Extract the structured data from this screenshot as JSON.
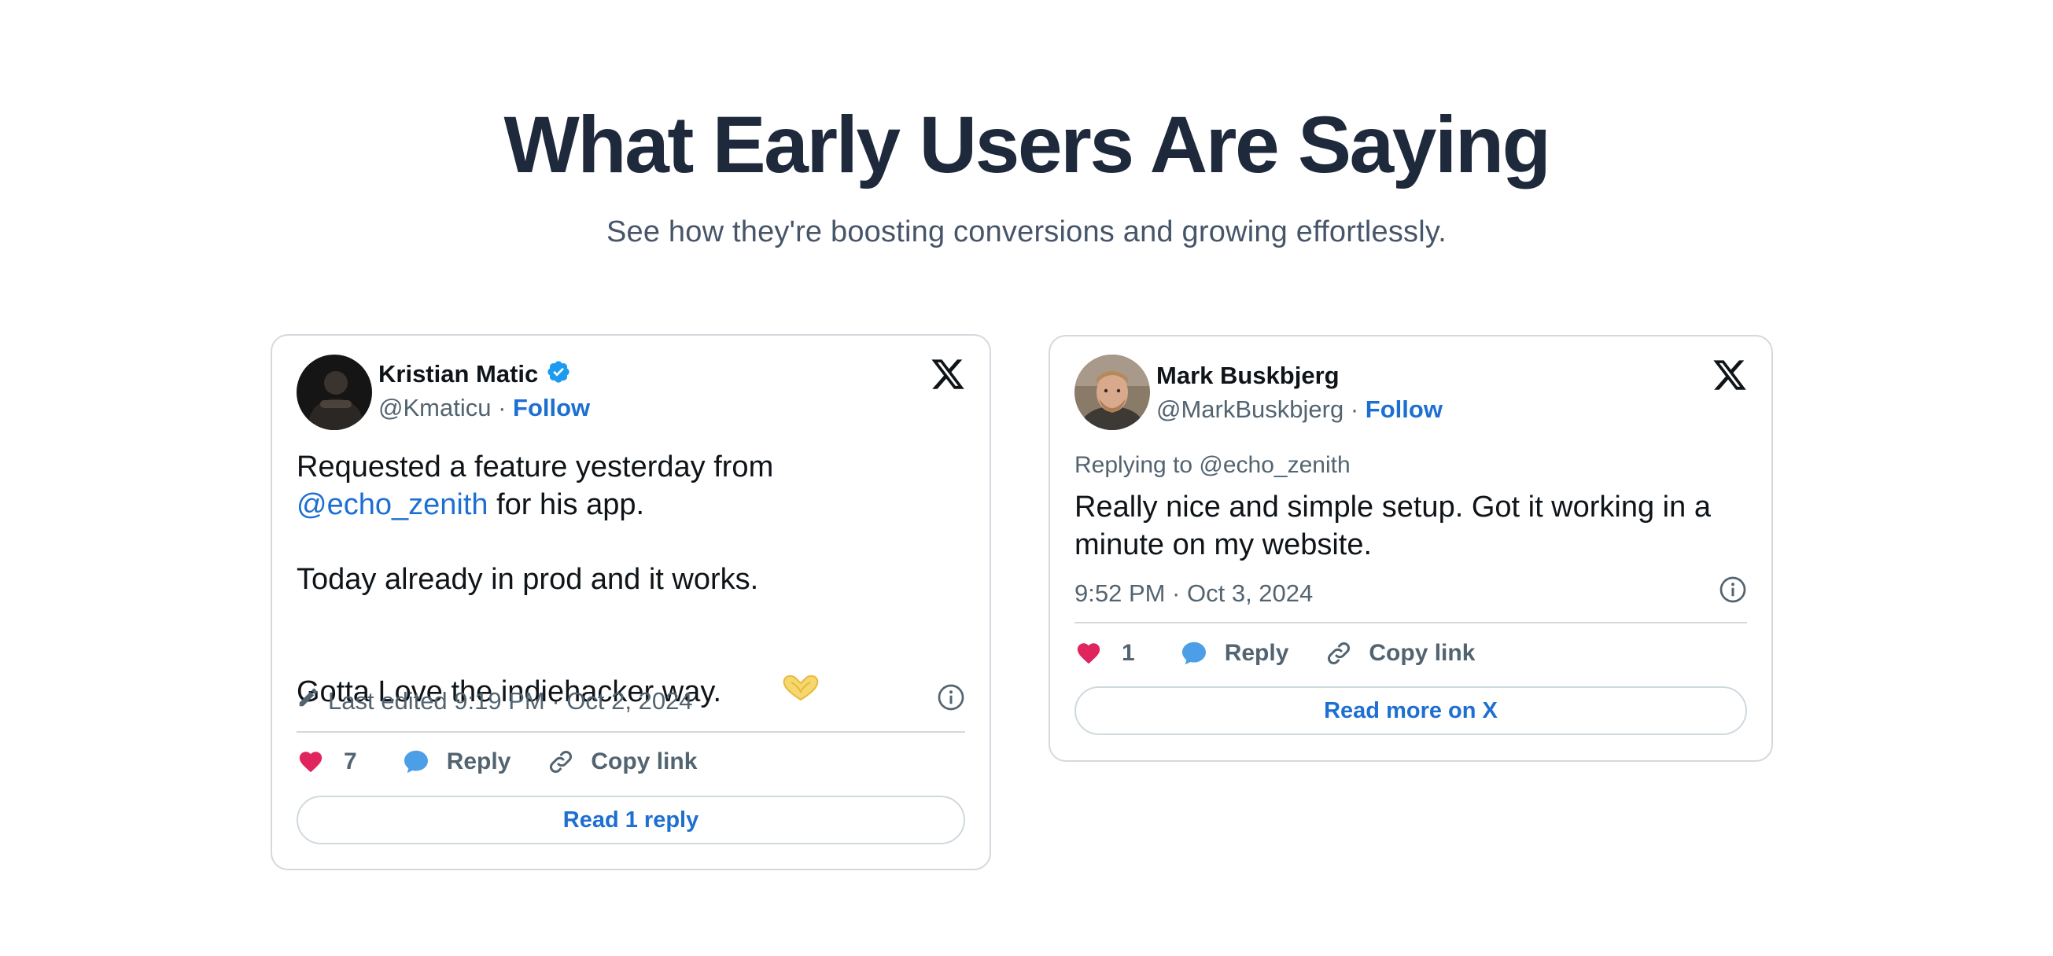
{
  "section": {
    "title": "What Early Users Are Saying",
    "subtitle": "See how they're boosting conversions and growing effortlessly."
  },
  "tweets": [
    {
      "name": "Kristian Matic",
      "verified": true,
      "handle": "@Kmaticu",
      "separator": " · ",
      "follow_label": "Follow",
      "text_line1": "Requested a feature yesterday from",
      "mention": "@echo_zenith",
      "text_line2_rest": " for his app.",
      "text_line3": "Today already in prod and it works.",
      "text_line4": "Gotta Love the indiehacker way.",
      "emoji": "heart-hands-emoji",
      "meta_text": "Last edited 9:19 PM · Oct 2, 2024",
      "likes": "7",
      "reply_label": "Reply",
      "copy_label": "Copy link",
      "button_label": "Read 1 reply",
      "icons": [
        "pencil-icon",
        "info-icon",
        "heart-icon",
        "reply-bubble-icon",
        "link-icon",
        "x-logo-icon",
        "verified-badge-icon"
      ]
    },
    {
      "name": "Mark Buskbjerg",
      "verified": false,
      "handle": "@MarkBuskbjerg",
      "separator": " · ",
      "follow_label": "Follow",
      "replying_to": "Replying to @echo_zenith",
      "text_line1": "Really nice and simple setup. Got it working in a",
      "text_line2": "minute on my website.",
      "meta_text": "9:52 PM · Oct 3, 2024",
      "likes": "1",
      "reply_label": "Reply",
      "copy_label": "Copy link",
      "button_label": "Read more on X",
      "icons": [
        "info-icon",
        "heart-icon",
        "reply-bubble-icon",
        "link-icon",
        "x-logo-icon"
      ]
    }
  ],
  "colors": {
    "heading": "#1e293b",
    "link": "#1d6fd1",
    "heart": "#e0245e",
    "reply_bubble": "#4c9fe6",
    "verified": "#1d9bf0"
  }
}
